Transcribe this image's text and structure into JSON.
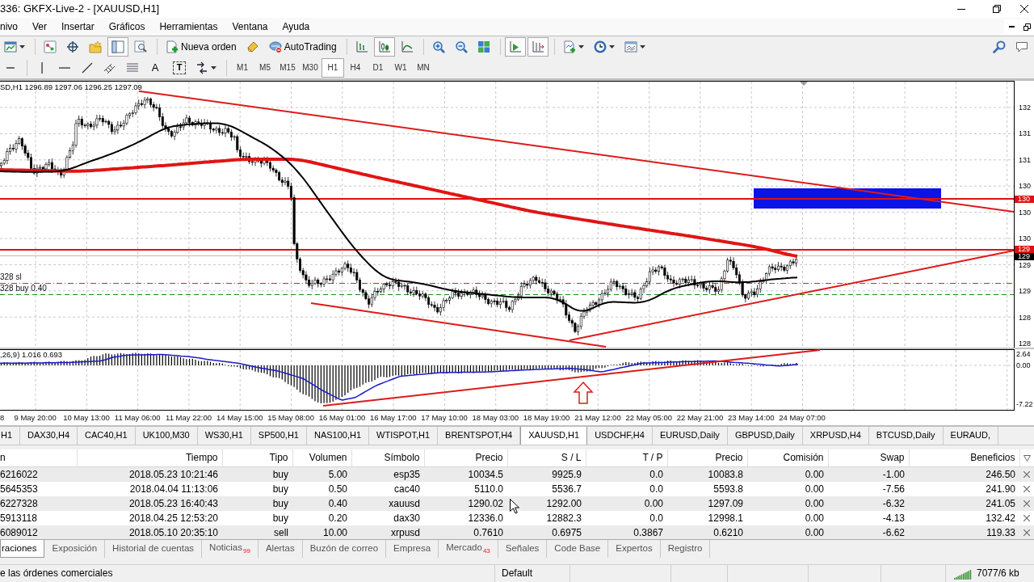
{
  "window": {
    "title": "336: GKFX-Live-2 - [XAUUSD,H1]"
  },
  "menu": [
    "nivo",
    "Ver",
    "Insertar",
    "Gráficos",
    "Herramientas",
    "Ventana",
    "Ayuda"
  ],
  "standard_toolbar": {
    "navigator": {
      "on": true
    },
    "new_order": "Nueva orden",
    "autotrading": "AutoTrading",
    "chart_types": [
      {
        "selected": false
      },
      {
        "selected": true
      },
      {
        "selected": false
      }
    ],
    "auto_scroll": {
      "on": true
    },
    "chart_shift": {
      "on": true
    }
  },
  "line_studies": {
    "text_tool": "A",
    "label_tool": "T"
  },
  "timeframes": [
    {
      "label": "M1",
      "selected": false
    },
    {
      "label": "M5",
      "selected": false
    },
    {
      "label": "M15",
      "selected": false
    },
    {
      "label": "M30",
      "selected": false
    },
    {
      "label": "H1",
      "selected": true
    },
    {
      "label": "H4",
      "selected": false
    },
    {
      "label": "D1",
      "selected": false
    },
    {
      "label": "W1",
      "selected": false
    },
    {
      "label": "MN",
      "selected": false
    }
  ],
  "chart": {
    "legend": "SD,H1 1296.89 1297.06 1296.25 1297.09",
    "order_labels": [
      "328 sl",
      "328 buy 0.40"
    ],
    "price_axis": [
      "132",
      "131",
      "131",
      "130",
      "130",
      "130",
      "129",
      "129",
      "128",
      "128"
    ],
    "price_tags": [
      {
        "text": "130",
        "kind": "level"
      },
      {
        "text": "129",
        "kind": "level"
      },
      {
        "text": "129",
        "kind": "bid"
      }
    ],
    "indicator_legend": ",26,9) 1.016 0.693",
    "indicator_axis": [
      "2.64",
      "0.00",
      "-7.22"
    ],
    "time_axis": [
      "8",
      "9 May 20:00",
      "10 May 13:00",
      "11 May 06:00",
      "11 May 22:00",
      "14 May 15:00",
      "15 May 08:00",
      "16 May 01:00",
      "16 May 17:00",
      "17 May 10:00",
      "18 May 03:00",
      "18 May 19:00",
      "21 May 12:00",
      "22 May 05:00",
      "22 May 21:00",
      "23 May 14:00",
      "24 May 07:00"
    ]
  },
  "chart_tabs": [
    {
      "label": "H1",
      "selected": false
    },
    {
      "label": "DAX30,H4",
      "selected": false
    },
    {
      "label": "CAC40,H1",
      "selected": false
    },
    {
      "label": "UK100,M30",
      "selected": false
    },
    {
      "label": "WS30,H1",
      "selected": false
    },
    {
      "label": "SP500,H1",
      "selected": false
    },
    {
      "label": "NAS100,H1",
      "selected": false
    },
    {
      "label": "WTISPOT,H1",
      "selected": false
    },
    {
      "label": "BRENTSPOT,H4",
      "selected": false
    },
    {
      "label": "XAUUSD,H1",
      "selected": true
    },
    {
      "label": "USDCHF,H4",
      "selected": false
    },
    {
      "label": "EURUSD,Daily",
      "selected": false
    },
    {
      "label": "GBPUSD,Daily",
      "selected": false
    },
    {
      "label": "XRPUSD,H4",
      "selected": false
    },
    {
      "label": "BTCUSD,Daily",
      "selected": false
    },
    {
      "label": "EURAUD,",
      "selected": false
    }
  ],
  "trade_table": {
    "columns": [
      "n",
      "Tiempo",
      "Tipo",
      "Volumen",
      "Símbolo",
      "Precio",
      "S / L",
      "T / P",
      "Precio",
      "Comisión",
      "Swap",
      "Beneficios"
    ],
    "rows": [
      [
        "6216022",
        "2018.05.23 10:21:46",
        "buy",
        "5.00",
        "esp35",
        "10034.5",
        "9925.9",
        "0.0",
        "10083.8",
        "0.00",
        "-1.00",
        "246.50"
      ],
      [
        "5645353",
        "2018.04.04 11:13:06",
        "buy",
        "0.50",
        "cac40",
        "5110.0",
        "5536.7",
        "0.0",
        "5593.8",
        "0.00",
        "-7.56",
        "241.90"
      ],
      [
        "6227328",
        "2018.05.23 16:40:43",
        "buy",
        "0.40",
        "xauusd",
        "1290.02",
        "1292.00",
        "0.00",
        "1297.09",
        "0.00",
        "-6.32",
        "241.05"
      ],
      [
        "5913118",
        "2018.04.25 12:53:20",
        "buy",
        "0.20",
        "dax30",
        "12336.0",
        "12882.3",
        "0.0",
        "12998.1",
        "0.00",
        "-4.13",
        "132.42"
      ],
      [
        "6089012",
        "2018.05.10 20:35:10",
        "sell",
        "10.00",
        "xrpusd",
        "0.7610",
        "0.6975",
        "0.3867",
        "0.6210",
        "0.00",
        "-6.62",
        "119.33"
      ]
    ]
  },
  "terminal_tabs": [
    {
      "label": "raciones",
      "selected": true
    },
    {
      "label": "Exposición",
      "selected": false
    },
    {
      "label": "Historial de cuentas",
      "selected": false
    },
    {
      "label": "Noticias",
      "badge": "99",
      "selected": false
    },
    {
      "label": "Alertas",
      "selected": false
    },
    {
      "label": "Buzón de correo",
      "selected": false
    },
    {
      "label": "Empresa",
      "selected": false
    },
    {
      "label": "Mercado",
      "badge": "43",
      "selected": false
    },
    {
      "label": "Señales",
      "selected": false
    },
    {
      "label": "Code Base",
      "selected": false
    },
    {
      "label": "Expertos",
      "selected": false
    },
    {
      "label": "Registro",
      "selected": false
    }
  ],
  "status_bar": {
    "hint": "e las órdenes comerciales",
    "profile": "Default",
    "traffic": "7077/6 kb"
  }
}
